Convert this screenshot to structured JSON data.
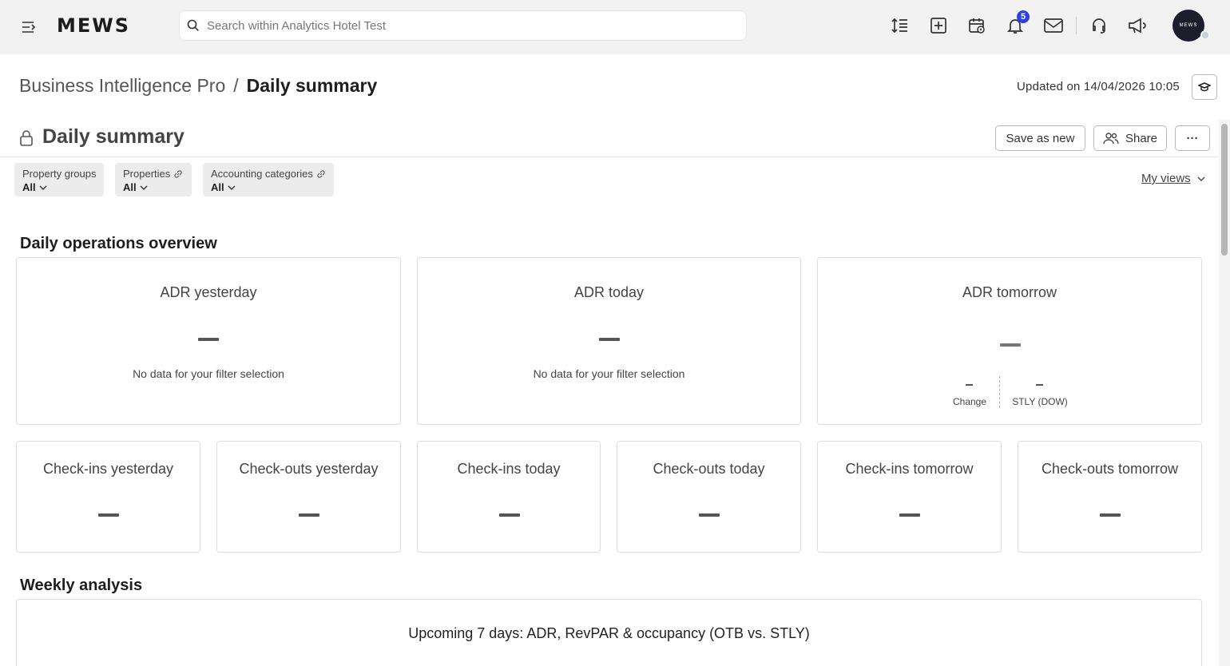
{
  "topbar": {
    "logo": "MEWS",
    "search_placeholder": "Search within Analytics Hotel Test",
    "notification_count": "5",
    "avatar_text": "MEWS"
  },
  "header": {
    "breadcrumb_parent": "Business Intelligence Pro",
    "breadcrumb_separator": "/",
    "breadcrumb_current": "Daily summary",
    "updated": "Updated on 14/04/2026 10:05"
  },
  "report": {
    "title": "Daily summary",
    "save_as_new": "Save as new",
    "share": "Share",
    "more": "···"
  },
  "filters": [
    {
      "label": "Property groups",
      "value": "All",
      "linked": false
    },
    {
      "label": "Properties",
      "value": "All",
      "linked": true
    },
    {
      "label": "Accounting categories",
      "value": "All",
      "linked": true
    }
  ],
  "my_views": "My views",
  "sections": {
    "daily": "Daily operations overview",
    "weekly": "Weekly analysis"
  },
  "adr_cards": [
    {
      "title": "ADR yesterday",
      "message": "No data for your filter selection"
    },
    {
      "title": "ADR today",
      "message": "No data for your filter selection"
    },
    {
      "title": "ADR tomorrow",
      "change_label": "Change",
      "stly_label": "STLY (DOW)"
    }
  ],
  "count_cards": [
    {
      "title": "Check-ins yesterday"
    },
    {
      "title": "Check-outs yesterday"
    },
    {
      "title": "Check-ins today"
    },
    {
      "title": "Check-outs today"
    },
    {
      "title": "Check-ins tomorrow"
    },
    {
      "title": "Check-outs tomorrow"
    }
  ],
  "weekly_chart_title": "Upcoming 7 days: ADR, RevPAR & occupancy (OTB vs. STLY)"
}
